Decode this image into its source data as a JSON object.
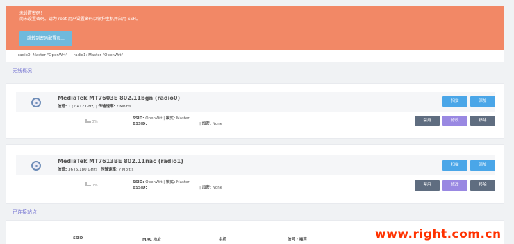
{
  "alert": {
    "title": "未设置密码！",
    "message": "尚未设置密码。请为 root 用户设置密码以保护主机并启用 SSH。",
    "button": "跳转到密码配置页..."
  },
  "tabs": [
    "radio0: Master \"OpenWrt\"",
    "radio1: Master \"OpenWrt\""
  ],
  "section_wireless": "无线概况",
  "devices": [
    {
      "name": "MediaTek MT7603E 802.11bgn (radio0)",
      "channel_label": "信道:",
      "channel": "1 (2.412 GHz)",
      "rate_label": "传输速率:",
      "rate": "? Mbit/s",
      "scan": "扫描",
      "add": "添加",
      "signal": "0%",
      "ssid_label": "SSID:",
      "ssid": "OpenWrt",
      "mode_label": "模式:",
      "mode": "Master",
      "bssid_label": "BSSID:",
      "bssid": "",
      "enc_label": "加密:",
      "enc": "None",
      "disable": "禁用",
      "edit": "修改",
      "remove": "移除"
    },
    {
      "name": "MediaTek MT7613BE 802.11nac (radio1)",
      "channel_label": "信道:",
      "channel": "36 (5.180 GHz)",
      "rate_label": "传输速率:",
      "rate": "? Mbit/s",
      "scan": "扫描",
      "add": "添加",
      "signal": "0%",
      "ssid_label": "SSID:",
      "ssid": "OpenWrt",
      "mode_label": "模式:",
      "mode": "Master",
      "bssid_label": "BSSID:",
      "bssid": "",
      "enc_label": "加密:",
      "enc": "None",
      "disable": "禁用",
      "edit": "修改",
      "remove": "移除"
    }
  ],
  "section_stations": "已连接站点",
  "stations_headers": [
    "SSID",
    "MAC 地址",
    "主机",
    "信号 / 噪声"
  ],
  "watermark": "www.right.com.cn"
}
